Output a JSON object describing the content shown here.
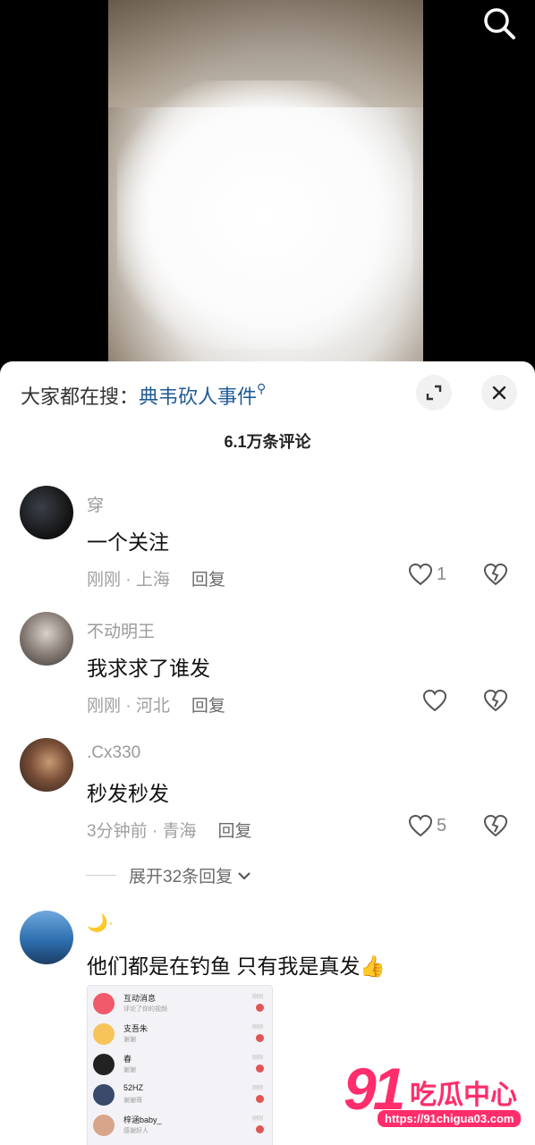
{
  "hot_search": {
    "prefix": "大家都在搜：",
    "keyword": "典韦砍人事件"
  },
  "comment_count": "6.1万条评论",
  "comments": [
    {
      "username": "穿",
      "text": "一个关注",
      "time": "刚刚",
      "location": "上海",
      "reply": "回复",
      "likes": "1"
    },
    {
      "username": "不动明王",
      "text": "我求求了谁发",
      "time": "刚刚",
      "location": "河北",
      "reply": "回复",
      "likes": ""
    },
    {
      "username": ".Cx330",
      "text": "秒发秒发",
      "time": "3分钟前",
      "location": "青海",
      "reply": "回复",
      "likes": "5",
      "expand": "展开32条回复"
    },
    {
      "username": "🌙·",
      "text": "他们都是在钓鱼 只有我是真发👍"
    }
  ],
  "attachment": {
    "rows": [
      {
        "name": "互动消息",
        "sub": "评论了你的视频",
        "time": "刚刚",
        "badge": "4"
      },
      {
        "name": "支吾朱",
        "sub": "谢谢",
        "time": "刚刚",
        "badge": "2"
      },
      {
        "name": "春",
        "sub": "谢谢",
        "time": "刚刚",
        "badge": "1"
      },
      {
        "name": "52HZ",
        "sub": "谢谢哥",
        "time": "刚刚",
        "badge": "1"
      },
      {
        "name": "梓涵baby_",
        "sub": "感谢好人",
        "time": "刚刚",
        "badge": "1"
      }
    ]
  },
  "watermark": {
    "number": "91",
    "text": "吃瓜中心",
    "url": "https://91chigua03.com"
  }
}
